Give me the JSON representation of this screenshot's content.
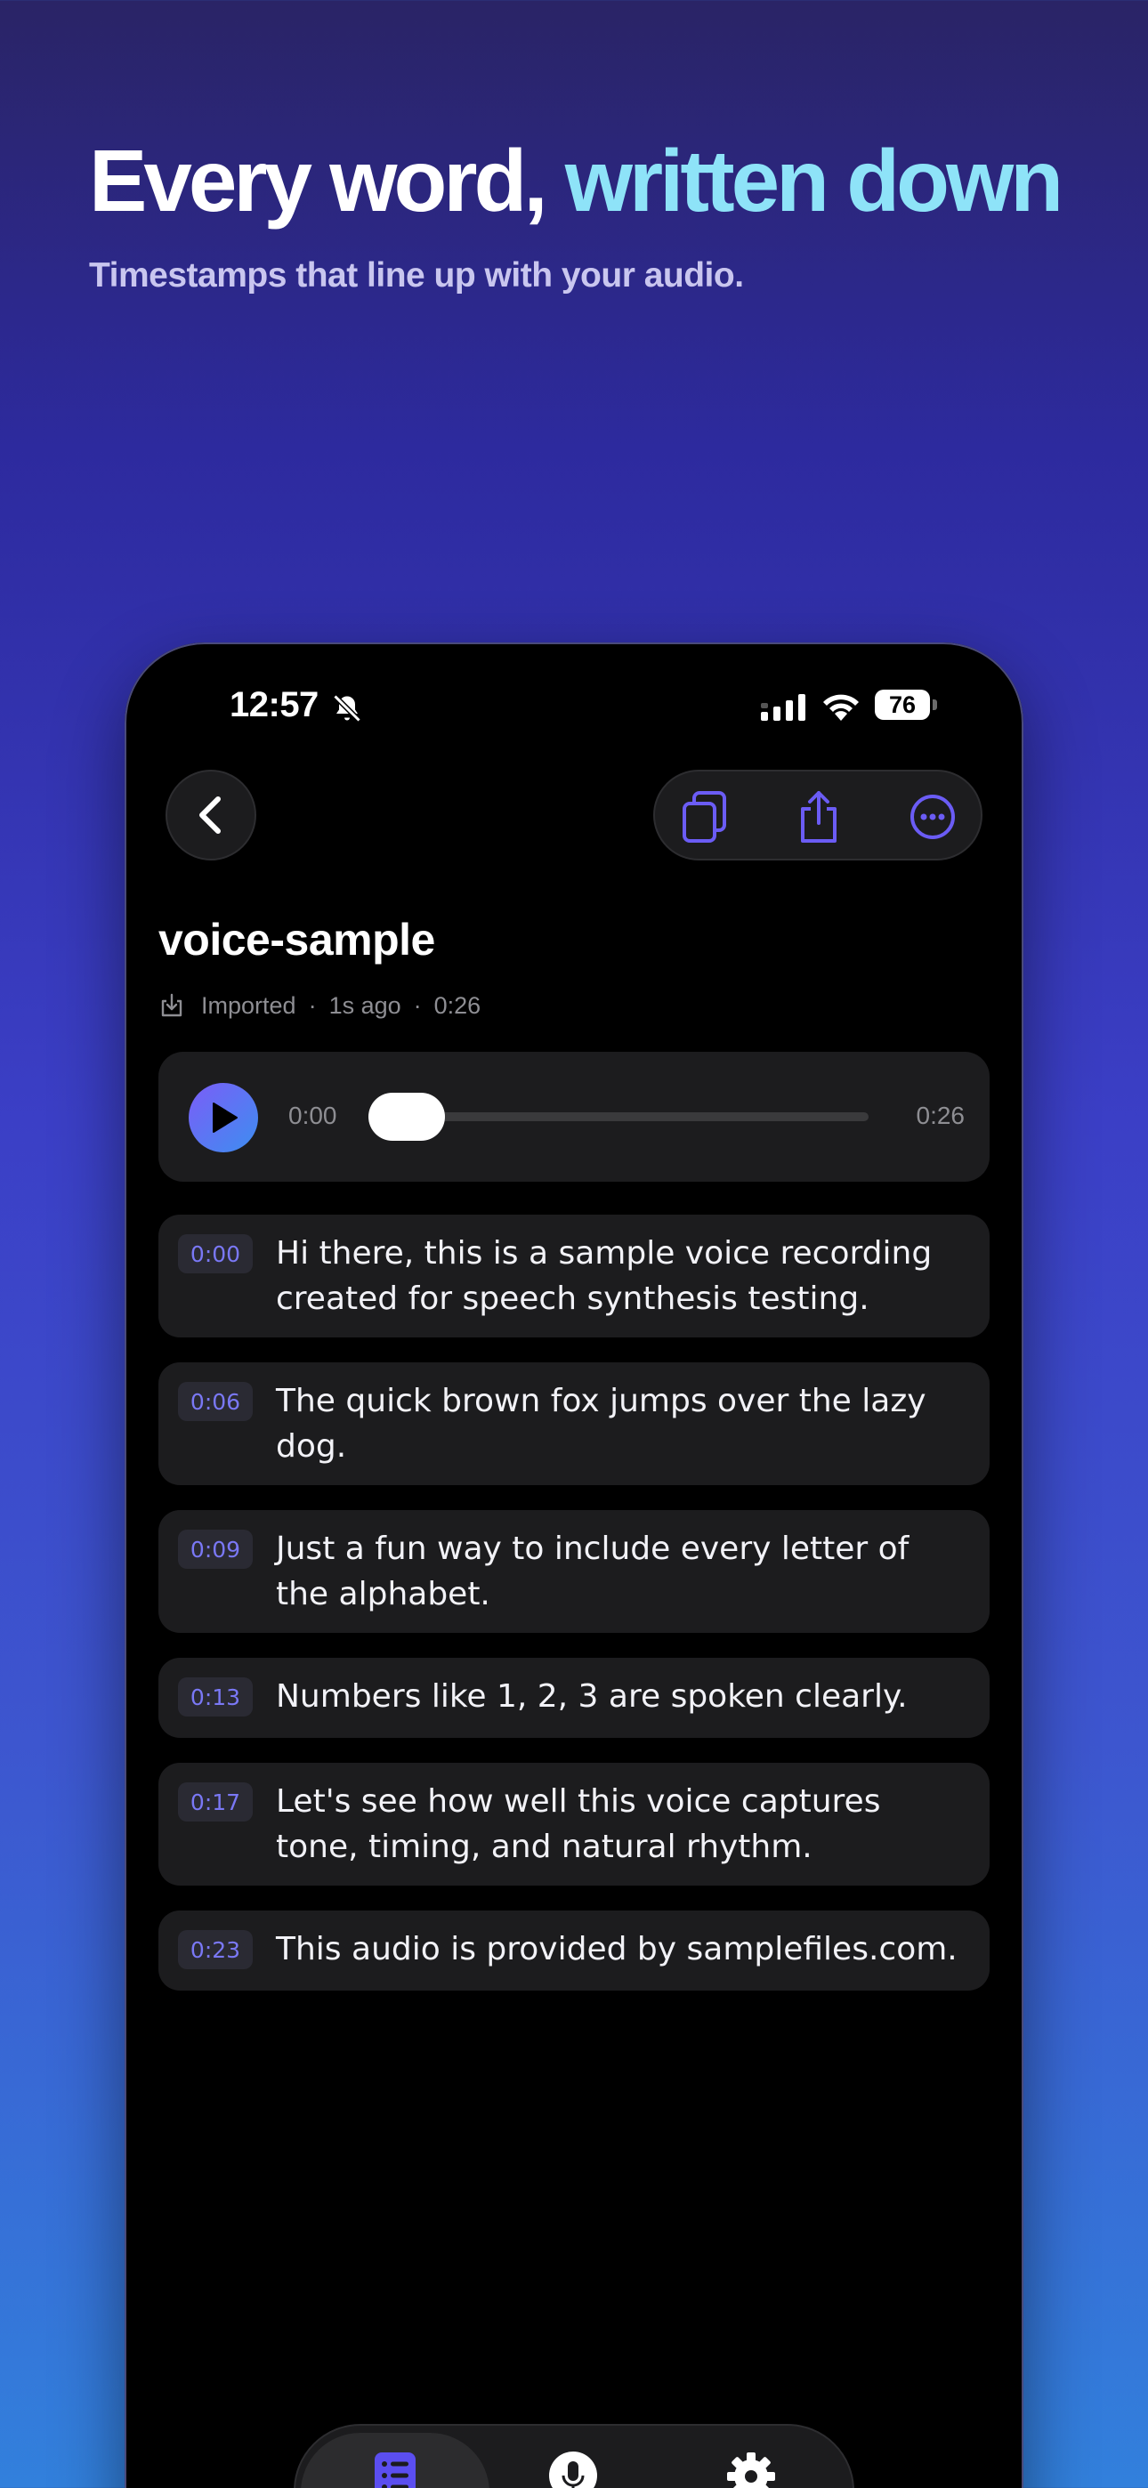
{
  "marketing": {
    "headline_part1": "Every word, ",
    "headline_part2": "written down",
    "subheadline": "Timestamps that line up with your audio."
  },
  "status_bar": {
    "time": "12:57",
    "battery": "76",
    "icons": [
      "bell-slash-icon",
      "signal-icon",
      "wifi-icon",
      "battery-icon"
    ]
  },
  "toolbar": {
    "back": "chevron-left-icon",
    "actions": [
      "copy-icon",
      "share-icon",
      "more-icon"
    ]
  },
  "recording": {
    "title": "voice-sample",
    "source": "Imported",
    "age": "1s ago",
    "duration": "0:26"
  },
  "player": {
    "current": "0:00",
    "duration": "0:26",
    "progress": 0.0
  },
  "segments": [
    {
      "time": "0:00",
      "text": "Hi there, this is a sample voice recording created for speech synthesis testing."
    },
    {
      "time": "0:06",
      "text": "The quick brown fox jumps over the lazy dog."
    },
    {
      "time": "0:09",
      "text": "Just a fun way to include every letter of the alphabet."
    },
    {
      "time": "0:13",
      "text": "Numbers like 1, 2, 3 are spoken clearly."
    },
    {
      "time": "0:17",
      "text": "Let's see how well this voice captures tone, timing, and natural rhythm."
    },
    {
      "time": "0:23",
      "text": "This audio is provided by samplefiles.com."
    }
  ],
  "tabbar": {
    "tabs": [
      "transcripts-icon",
      "microphone-icon",
      "settings-icon"
    ],
    "active": 0
  },
  "colors": {
    "accent": "#6b5cf5",
    "headline_accent": "#8ee3f8",
    "timestamp": "#7a78f5"
  }
}
